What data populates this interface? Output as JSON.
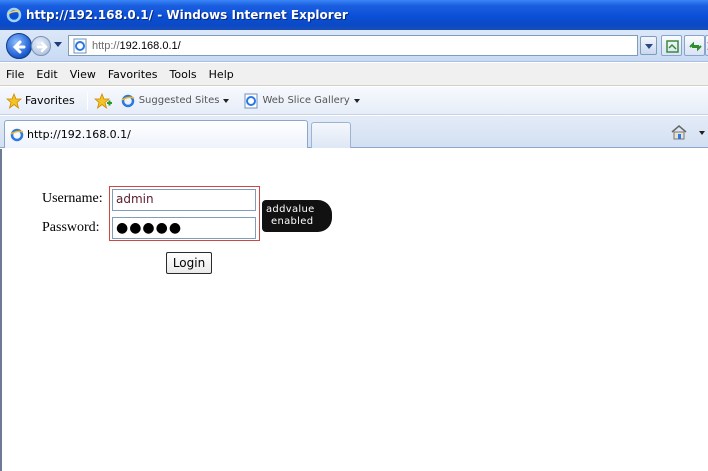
{
  "window": {
    "title": "http://192.168.0.1/ - Windows Internet Explorer"
  },
  "address_bar": {
    "url_prefix": "http://",
    "url_host": "192.168.0.1/"
  },
  "menu": {
    "items": [
      "File",
      "Edit",
      "View",
      "Favorites",
      "Tools",
      "Help"
    ]
  },
  "favorites_bar": {
    "favorites_label": "Favorites",
    "links": [
      {
        "label": "Suggested Sites",
        "icon": "ie-icon"
      },
      {
        "label": "Web Slice Gallery",
        "icon": "ie-page-icon"
      }
    ]
  },
  "tabs": {
    "active_label": "http://192.168.0.1/"
  },
  "login": {
    "username_label": "Username:",
    "password_label": "Password:",
    "username_value": "admin",
    "password_value": "●●●●●",
    "login_label": "Login"
  },
  "logo": {
    "line1": "addvalue",
    "line2": "enabled"
  },
  "colors": {
    "titlebar": "#0a4fd6",
    "highlight_border": "#d24545"
  }
}
